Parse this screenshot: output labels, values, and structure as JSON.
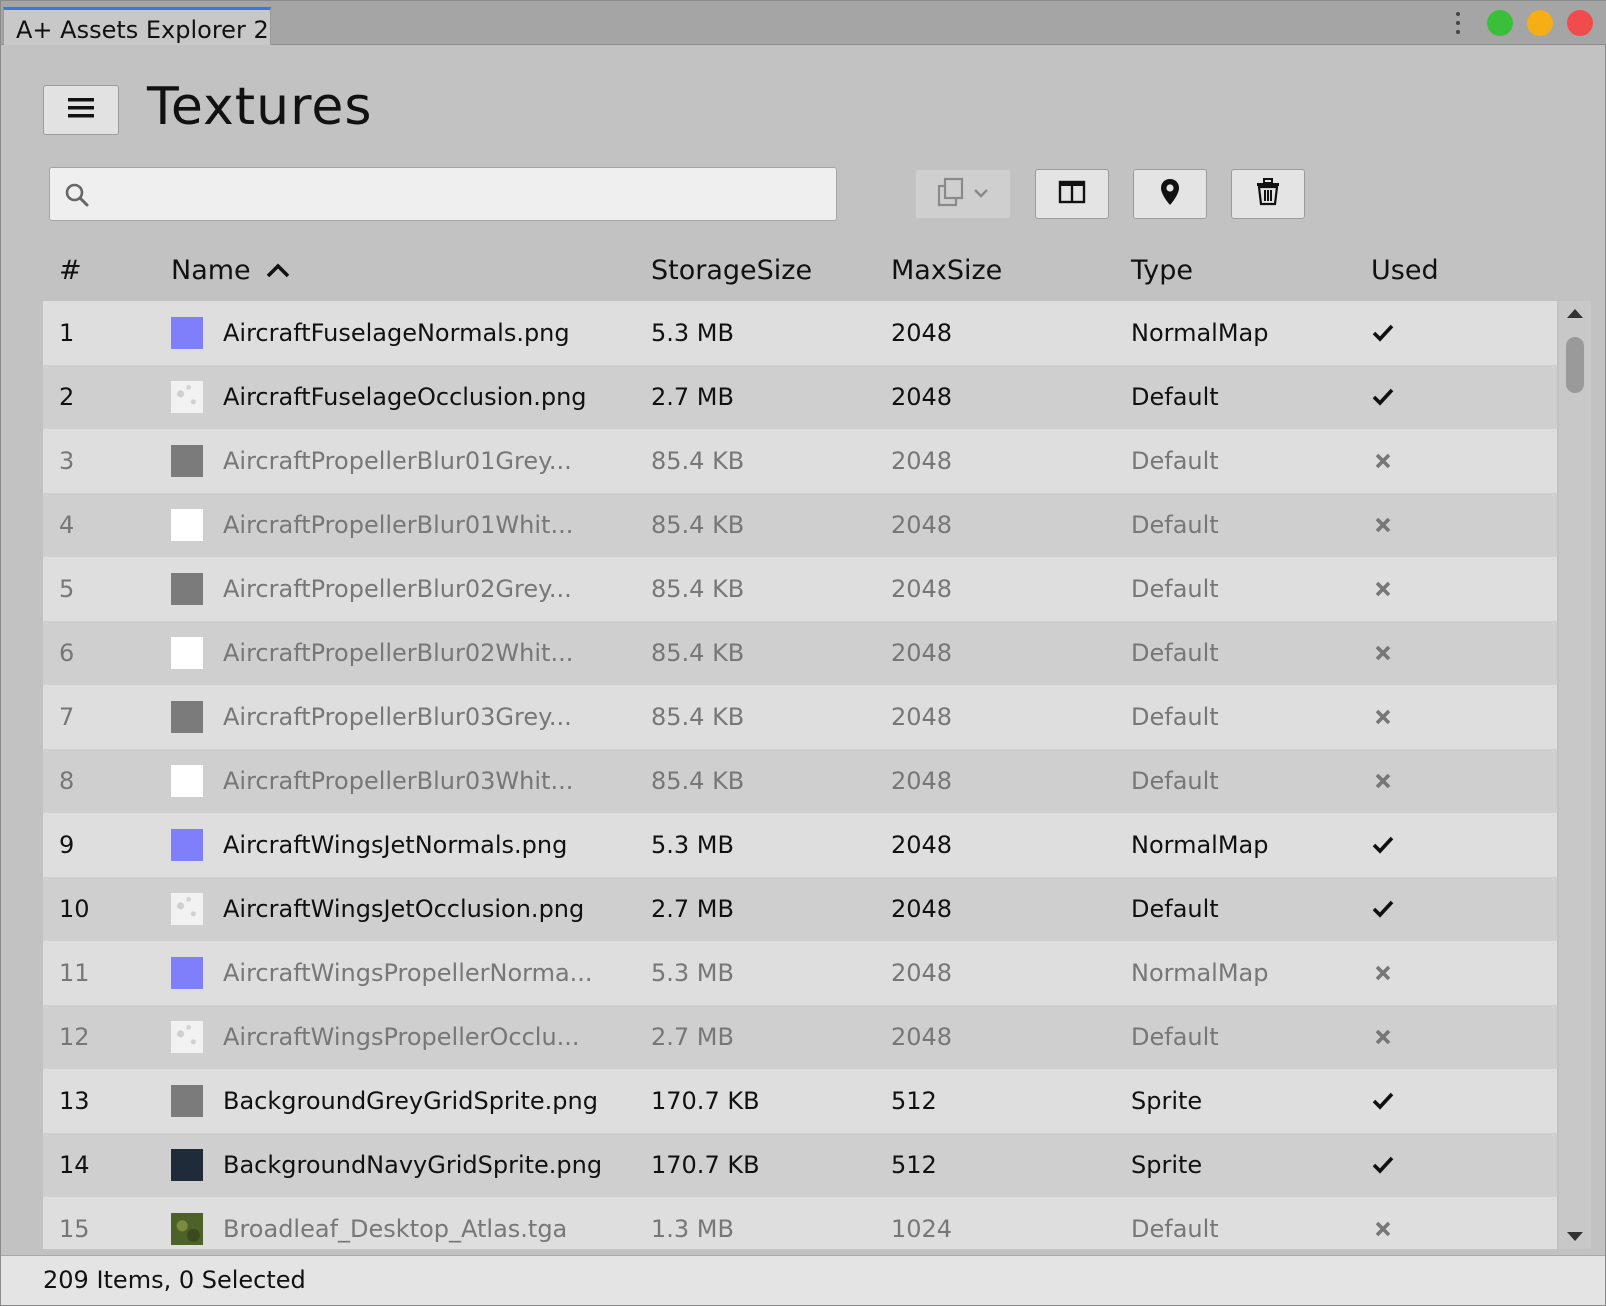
{
  "window": {
    "tab_title": "A+ Assets Explorer 2"
  },
  "header": {
    "title": "Textures"
  },
  "search": {
    "value": "",
    "placeholder": ""
  },
  "toolbar": {
    "copy_icon": "copy-dropdown-icon",
    "columns_icon": "columns-icon",
    "pin_icon": "map-pin-icon",
    "trash_icon": "trash-icon"
  },
  "table": {
    "columns": {
      "num": "#",
      "name": "Name",
      "storage": "StorageSize",
      "max": "MaxSize",
      "type": "Type",
      "used": "Used"
    },
    "sort": {
      "column": "Name",
      "direction": "ascending"
    },
    "rows": [
      {
        "num": "1",
        "name": "AircraftFuselageNormals.png",
        "storage": "5.3 MB",
        "max": "2048",
        "type": "NormalMap",
        "used": true,
        "thumb": "#7f7ffc"
      },
      {
        "num": "2",
        "name": "AircraftFuselageOcclusion.png",
        "storage": "2.7 MB",
        "max": "2048",
        "type": "Default",
        "used": true,
        "thumb": "noise"
      },
      {
        "num": "3",
        "name": "AircraftPropellerBlur01Grey...",
        "storage": "85.4 KB",
        "max": "2048",
        "type": "Default",
        "used": false,
        "thumb": "#7b7b7b"
      },
      {
        "num": "4",
        "name": "AircraftPropellerBlur01Whit...",
        "storage": "85.4 KB",
        "max": "2048",
        "type": "Default",
        "used": false,
        "thumb": "#ffffff"
      },
      {
        "num": "5",
        "name": "AircraftPropellerBlur02Grey...",
        "storage": "85.4 KB",
        "max": "2048",
        "type": "Default",
        "used": false,
        "thumb": "#7b7b7b"
      },
      {
        "num": "6",
        "name": "AircraftPropellerBlur02Whit...",
        "storage": "85.4 KB",
        "max": "2048",
        "type": "Default",
        "used": false,
        "thumb": "#ffffff"
      },
      {
        "num": "7",
        "name": "AircraftPropellerBlur03Grey...",
        "storage": "85.4 KB",
        "max": "2048",
        "type": "Default",
        "used": false,
        "thumb": "#7b7b7b"
      },
      {
        "num": "8",
        "name": "AircraftPropellerBlur03Whit...",
        "storage": "85.4 KB",
        "max": "2048",
        "type": "Default",
        "used": false,
        "thumb": "#ffffff"
      },
      {
        "num": "9",
        "name": "AircraftWingsJetNormals.png",
        "storage": "5.3 MB",
        "max": "2048",
        "type": "NormalMap",
        "used": true,
        "thumb": "#7f7ffc"
      },
      {
        "num": "10",
        "name": "AircraftWingsJetOcclusion.png",
        "storage": "2.7 MB",
        "max": "2048",
        "type": "Default",
        "used": true,
        "thumb": "noise"
      },
      {
        "num": "11",
        "name": "AircraftWingsPropellerNorma...",
        "storage": "5.3 MB",
        "max": "2048",
        "type": "NormalMap",
        "used": false,
        "thumb": "#7f7ffc"
      },
      {
        "num": "12",
        "name": "AircraftWingsPropellerOcclu...",
        "storage": "2.7 MB",
        "max": "2048",
        "type": "Default",
        "used": false,
        "thumb": "noise"
      },
      {
        "num": "13",
        "name": "BackgroundGreyGridSprite.png",
        "storage": "170.7 KB",
        "max": "512",
        "type": "Sprite",
        "used": true,
        "thumb": "#7b7b7b"
      },
      {
        "num": "14",
        "name": "BackgroundNavyGridSprite.png",
        "storage": "170.7 KB",
        "max": "512",
        "type": "Sprite",
        "used": true,
        "thumb": "#1f2b38"
      },
      {
        "num": "15",
        "name": "Broadleaf_Desktop_Atlas.tga",
        "storage": "1.3 MB",
        "max": "1024",
        "type": "Default",
        "used": false,
        "thumb": "leaf"
      }
    ]
  },
  "status": {
    "text": "209 Items, 0 Selected"
  },
  "colors": {
    "accent_tab": "#3a79d6",
    "dot_green": "#3bbf3b",
    "dot_yellow": "#f5ae16",
    "dot_red": "#f24b4b"
  }
}
